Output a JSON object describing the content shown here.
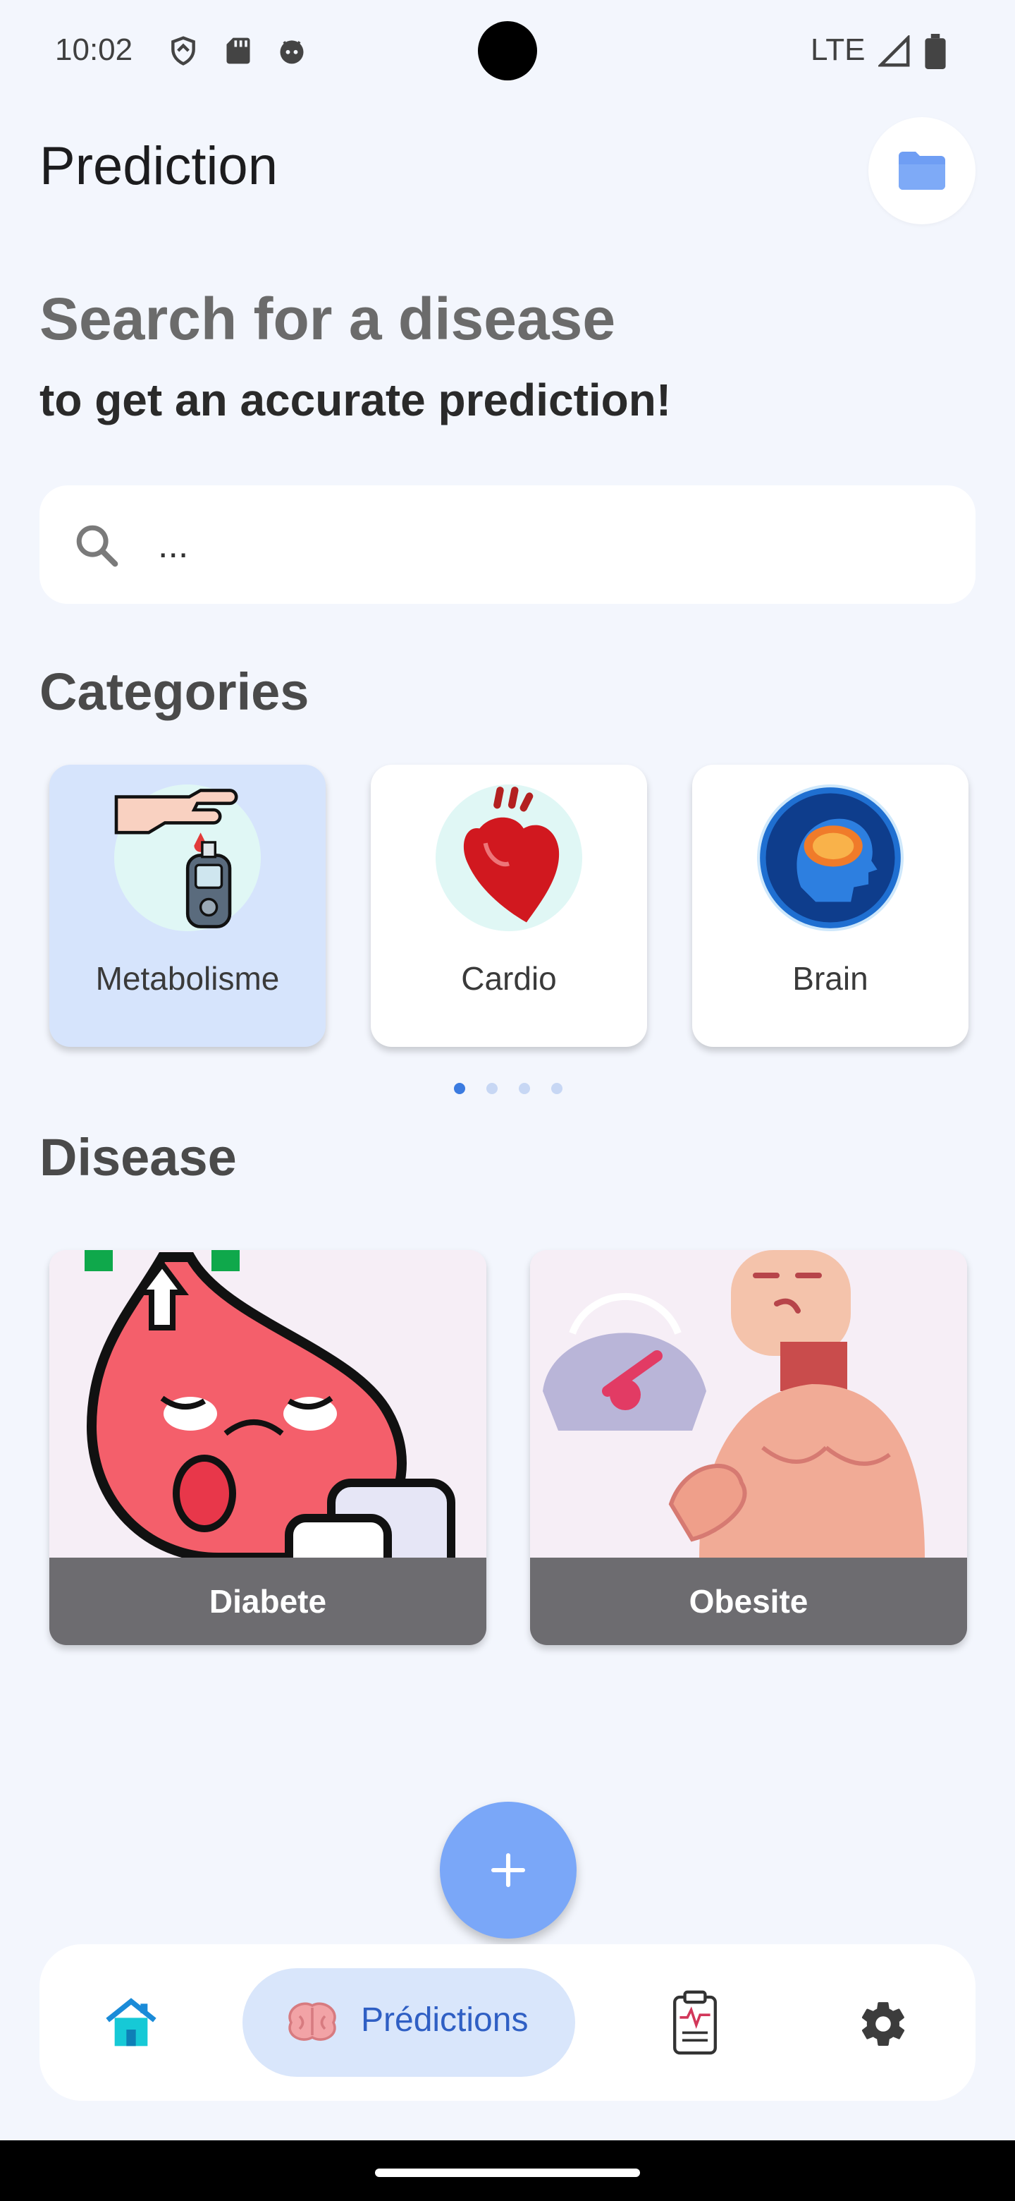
{
  "status_bar": {
    "time": "10:02",
    "network": "LTE"
  },
  "app_bar": {
    "title": "Prediction",
    "action_icon": "folder-icon"
  },
  "hero": {
    "headline": "Search for a disease",
    "subheadline": "to get an accurate prediction!"
  },
  "search": {
    "value": "...",
    "icon": "search-icon"
  },
  "categories": {
    "title": "Categories",
    "items": [
      {
        "label": "Metabolisme",
        "selected": true
      },
      {
        "label": "Cardio",
        "selected": false
      },
      {
        "label": "Brain",
        "selected": false
      }
    ],
    "pager": {
      "pages": 4,
      "current": 1
    }
  },
  "diseases": {
    "title": "Disease",
    "items": [
      {
        "label": "Diabete"
      },
      {
        "label": "Obesite"
      }
    ]
  },
  "fab": {
    "icon": "plus-icon"
  },
  "bottom_nav": {
    "items": [
      {
        "icon": "home-icon"
      },
      {
        "icon": "brain-icon",
        "label": "Prédictions",
        "active": true
      },
      {
        "icon": "clipboard-icon"
      },
      {
        "icon": "gear-icon"
      }
    ]
  },
  "colors": {
    "background": "#f3f6fd",
    "accent": "#7aa7f8",
    "selected_card": "#d6e4fc",
    "nav_active": "#2f5fc4"
  }
}
